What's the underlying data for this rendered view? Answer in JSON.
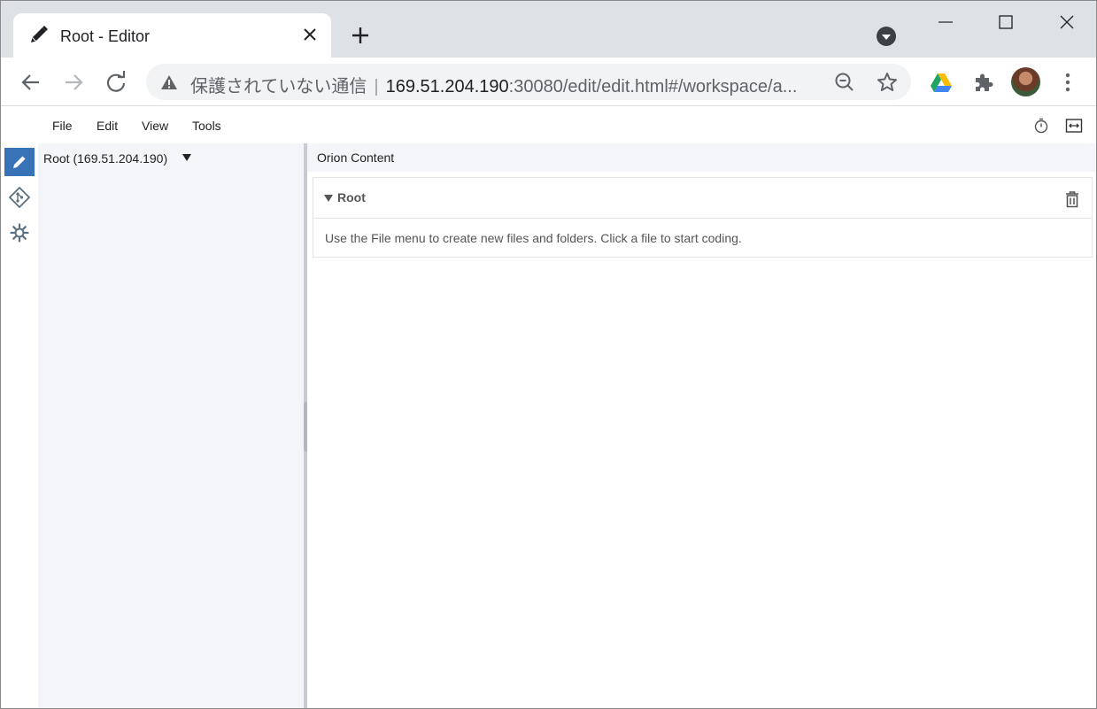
{
  "browser": {
    "tab": {
      "title": "Root - Editor",
      "favicon": "pencil-icon"
    },
    "address": {
      "security_label": "保護されていない通信",
      "separator": "|",
      "host": "169.51.204.190",
      "rest": ":30080/edit/edit.html#/workspace/a..."
    }
  },
  "menubar": {
    "items": [
      "File",
      "Edit",
      "View",
      "Tools"
    ],
    "right_icons": [
      "timer-icon",
      "expand-width-icon"
    ]
  },
  "rail": {
    "items": [
      {
        "name": "edit",
        "icon": "pencil-icon",
        "active": true
      },
      {
        "name": "git",
        "icon": "git-icon",
        "active": false
      },
      {
        "name": "settings",
        "icon": "gear-icon",
        "active": false
      }
    ]
  },
  "navigator": {
    "root_label": "Root (169.51.204.190)"
  },
  "main": {
    "header": "Orion Content",
    "section": {
      "title": "Root",
      "body": "Use the File menu to create new files and folders. Click a file to start coding."
    }
  },
  "colors": {
    "accent": "#3873b8",
    "navigator_bg": "#f4f5f8",
    "tabstrip_bg": "#dee1e6"
  }
}
